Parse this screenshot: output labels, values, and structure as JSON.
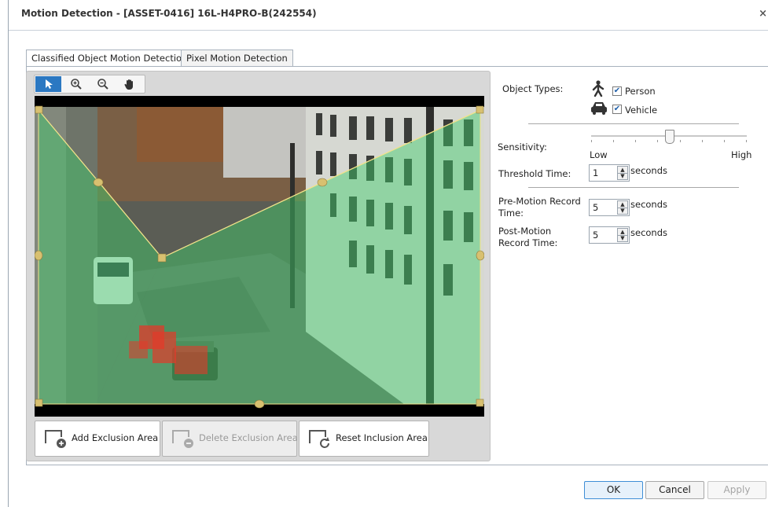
{
  "window": {
    "title": "Motion Detection - [ASSET-0416] 16L-H4PRO-B(242554)"
  },
  "tabs": [
    {
      "label": "Classified Object Motion Detection",
      "active": true
    },
    {
      "label": "Pixel Motion Detection",
      "active": false
    }
  ],
  "toolbar": {
    "tools": [
      "select-arrow-icon",
      "zoom-in-icon",
      "zoom-out-icon",
      "pan-hand-icon"
    ],
    "selected": "select-arrow-icon"
  },
  "actions": {
    "add_exclusion": "Add Exclusion Area",
    "delete_exclusion": "Delete Exclusion Area",
    "reset_inclusion": "Reset Inclusion Area"
  },
  "settings": {
    "object_types_label": "Object Types:",
    "person": {
      "label": "Person",
      "checked": true
    },
    "vehicle": {
      "label": "Vehicle",
      "checked": true
    },
    "sensitivity": {
      "label": "Sensitivity:",
      "low": "Low",
      "high": "High",
      "level": 0.5
    },
    "threshold": {
      "label": "Threshold Time:",
      "value": "1",
      "unit": "seconds"
    },
    "pre_motion": {
      "label_line1": "Pre-Motion Record",
      "label_line2": "Time:",
      "value": "5",
      "unit": "seconds"
    },
    "post_motion": {
      "label_line1": "Post-Motion",
      "label_line2": "Record Time:",
      "value": "5",
      "unit": "seconds"
    }
  },
  "footer": {
    "ok": "OK",
    "cancel": "Cancel",
    "apply": "Apply"
  },
  "colors": {
    "accent": "#2b78c2",
    "inclusion_area": "#3fcf6a",
    "handle": "#d8c070",
    "motion": "#e23a2a"
  }
}
